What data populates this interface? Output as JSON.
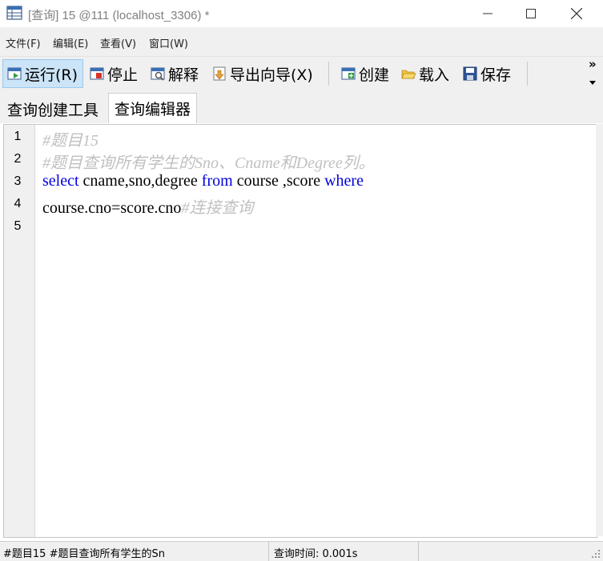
{
  "window": {
    "title": "[查询] 15 @111 (localhost_3306) *",
    "minimize_icon": "minimize-icon",
    "maximize_icon": "maximize-icon",
    "close_icon": "close-icon"
  },
  "menu": {
    "items": [
      "文件(F)",
      "编辑(E)",
      "查看(V)",
      "窗口(W)"
    ]
  },
  "toolbar": {
    "run": "运行(R)",
    "stop": "停止",
    "explain": "解释",
    "export": "导出向导(X)",
    "create": "创建",
    "load": "载入",
    "save": "保存",
    "overflow": "»"
  },
  "tabs": [
    "查询创建工具",
    "查询编辑器"
  ],
  "editor": {
    "line_numbers": [
      "1",
      "2",
      "3",
      "4",
      "5"
    ],
    "lines": [
      {
        "comment": "#题目15"
      },
      {
        "comment": "#题目查询所有学生的Sno、Cname和Degree列。"
      },
      {
        "kw1": "select",
        "text1": " cname,sno,degree ",
        "kw2": "from",
        "text2": " course ,score ",
        "kw3": "where"
      },
      {
        "text": "course.cno=score.cno",
        "comment": "#连接查询"
      },
      {}
    ]
  },
  "status": {
    "sql_preview": "#题目15 #题目查询所有学生的Sn",
    "query_time": "查询时间: 0.001s"
  },
  "colors": {
    "keyword": "#0000dd",
    "comment": "#c0c0c0",
    "active_button": "#cce4f7"
  }
}
